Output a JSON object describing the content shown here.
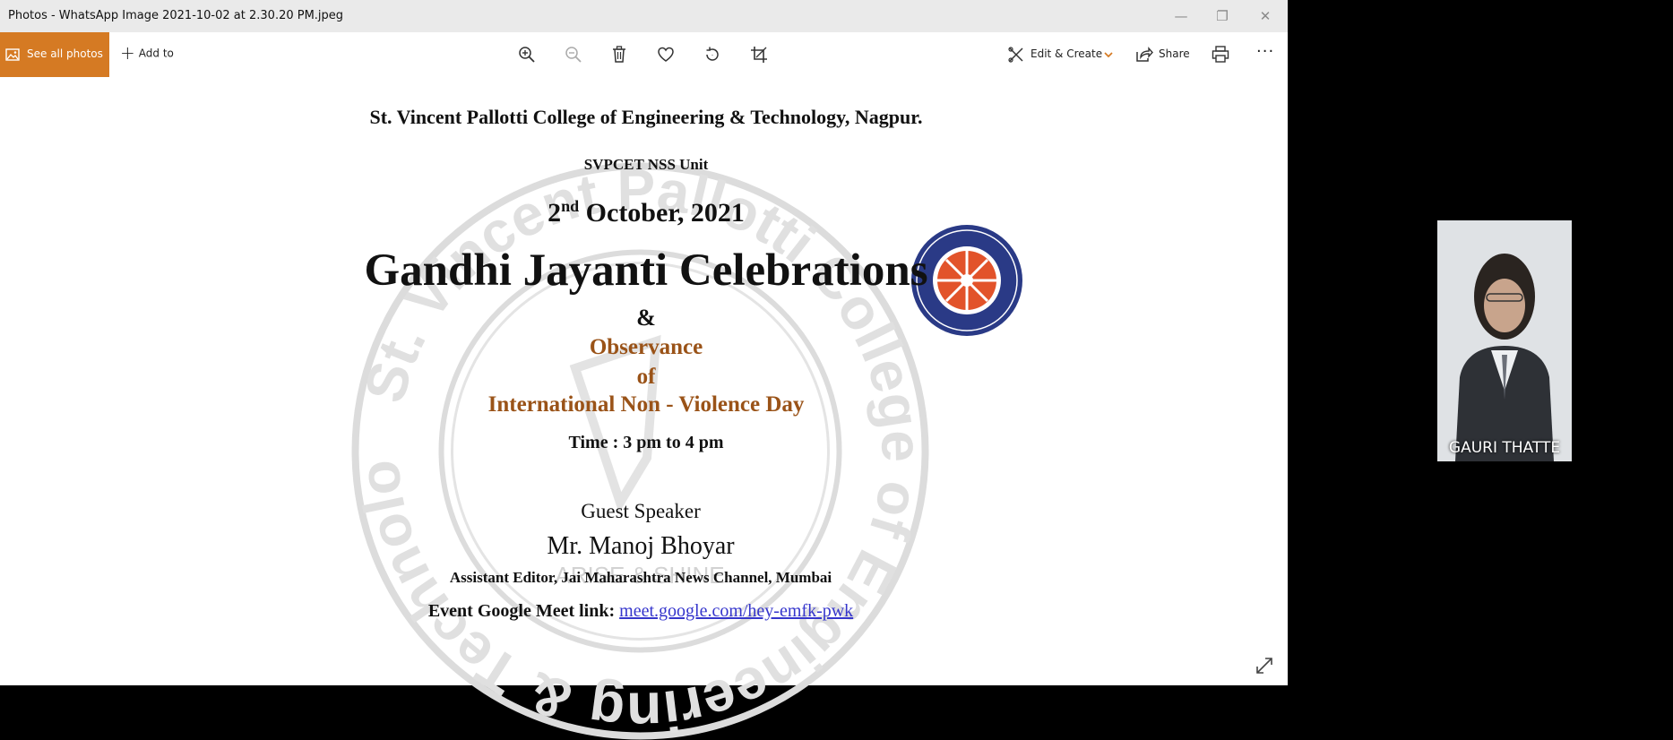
{
  "window": {
    "title": "Photos - WhatsApp Image 2021-10-02 at 2.30.20 PM.jpeg",
    "minimize": "—",
    "restore": "❐",
    "close": "✕"
  },
  "toolbar": {
    "see_all_photos": "See all photos",
    "add_to": "Add to",
    "edit_create": "Edit & Create",
    "share": "Share",
    "more": "···",
    "accent": "#d57a23",
    "icons": [
      "zoom-in-icon",
      "zoom-out-icon",
      "delete-icon",
      "favorite-icon",
      "rotate-icon",
      "crop-icon",
      "edit-create-icon",
      "share-icon",
      "print-icon",
      "more-icon"
    ]
  },
  "document": {
    "college": "St. Vincent Pallotti College of Engineering  & Technology,  Nagpur.",
    "unit": "SVPCET NSS Unit",
    "date_day": "2",
    "date_sup": "nd",
    "date_rest": " October, 2021",
    "event_title": "Gandhi Jayanti Celebrations",
    "ampersand": "&",
    "observance": "Observance",
    "of": "of",
    "international_day": "International Non - Violence Day",
    "time": "Time : 3 pm  to 4 pm",
    "guest_label": "Guest Speaker",
    "guest_name": "Mr. Manoj Bhoyar",
    "guest_title": "Assistant Editor, Jai Maharashtra News Channel, Mumbai",
    "meet_label": "Event Google Meet link: ",
    "meet_link": "meet.google.com/hey-emfk-pwk",
    "seal_motto": "ARISE & SHINE",
    "seal_ring_text": "St. Vincent Pallotti College of Engineering & Technology • Nagpur •",
    "accent_brown": "#9a5318"
  },
  "participant": {
    "name": "GAURI THATTE"
  }
}
